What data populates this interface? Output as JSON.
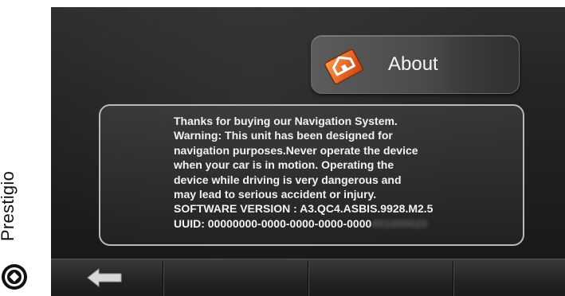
{
  "brand": {
    "name": "Prestigio"
  },
  "header": {
    "title": "About",
    "icon": "home-icon"
  },
  "info": {
    "lines": [
      "Thanks for buying our Navigation System.",
      "Warning: This unit has been designed for",
      "navigation purposes.Never operate the device",
      "when your car is in motion. Operating the",
      "device  while driving is very dangerous and",
      "may lead to serious accident or injury.",
      "SOFTWARE VERSION : A3.QC4.ASBIS.9928.M2.5"
    ],
    "uuid_label": "UUID: 00000000-0000-0000-0000-0000",
    "uuid_blurred": "491000020"
  },
  "toolbar": {
    "back_icon": "back-arrow-icon"
  },
  "colors": {
    "accent": "#e0581e",
    "screen_bg": "#242424",
    "text": "#f2f2f2"
  }
}
